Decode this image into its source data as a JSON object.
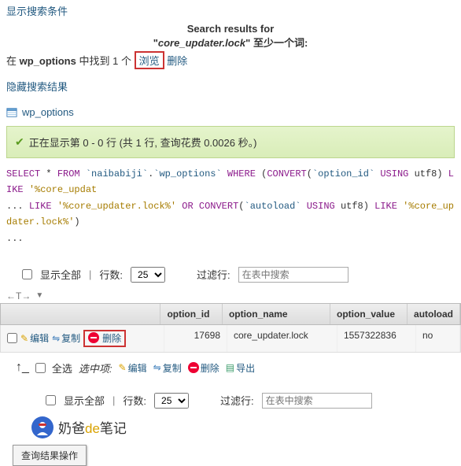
{
  "top": {
    "show_criteria": "显示搜索条件"
  },
  "search": {
    "results_for": "Search results for",
    "term": "core_updater.lock",
    "at_least": "至少一个词",
    "found_prefix": "在",
    "table": "wp_options",
    "found_mid": "中找到 1 个",
    "browse": "浏览",
    "delete": "删除"
  },
  "hide_results": "隐藏搜索结果",
  "table_name": "wp_options",
  "result_msg": "正在显示第 0 - 0 行 (共 1 行, 查询花费 0.0026 秒。)",
  "sql": {
    "select": "SELECT",
    "star": "*",
    "from": "FROM",
    "t_db": "`naibabiji`",
    "t_tbl": "`wp_options`",
    "where": "WHERE",
    "convert": "CONVERT",
    "c_option_id": "`option_id`",
    "using": "USING",
    "utf8": "utf8",
    "like": "LIKE",
    "s1": "'%core_updat",
    "ellipsis1": "...",
    "like2": "LIKE",
    "s2": "'%core_updater.lock%'",
    "or": "OR",
    "c_autoload": "`autoload`",
    "s3": "'%core_updater.lock%'",
    "ellipsis2": "..."
  },
  "controls": {
    "show_all": "显示全部",
    "rows_label": "行数:",
    "rows_value": "25",
    "filter_label": "过滤行:",
    "filter_placeholder": "在表中搜索"
  },
  "columns": {
    "option_id": "option_id",
    "option_name": "option_name",
    "option_value": "option_value",
    "autoload": "autoload"
  },
  "row_actions": {
    "edit": "编辑",
    "copy": "复制",
    "delete": "删除"
  },
  "data_row": {
    "option_id": "17698",
    "option_name": "core_updater.lock",
    "option_value": "1557322836",
    "autoload": "no"
  },
  "bulk": {
    "select_all": "全选",
    "selected": "选中项:",
    "edit": "编辑",
    "copy": "复制",
    "delete": "删除",
    "export": "导出"
  },
  "footer_brand": {
    "a": "奶爸",
    "b": "de",
    "c": "笔记"
  },
  "popup": "查询结果操作"
}
